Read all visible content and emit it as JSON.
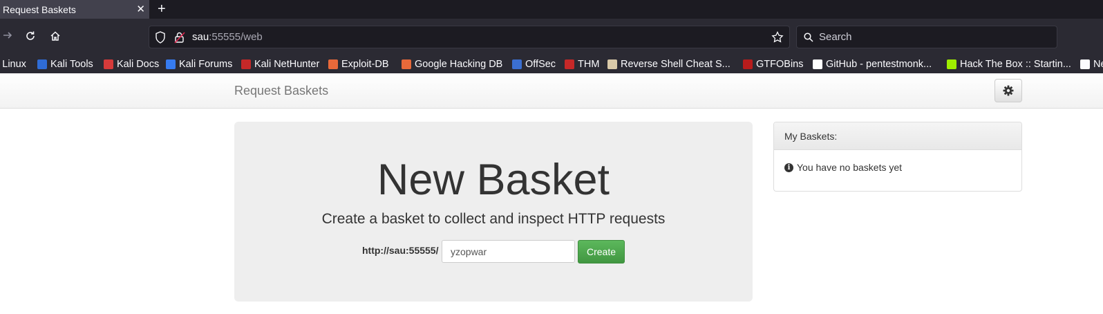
{
  "browser": {
    "tab_title": "Request Baskets",
    "tab_close_glyph": "✕",
    "new_tab_glyph": "+",
    "url_host": "sau",
    "url_rest": ":55555/web",
    "search_placeholder": "Search"
  },
  "bookmarks": [
    {
      "label": "i Linux",
      "color": "#367bf0"
    },
    {
      "label": "Kali Tools",
      "color": "#2f6cd6"
    },
    {
      "label": "Kali Docs",
      "color": "#d63a3a"
    },
    {
      "label": "Kali Forums",
      "color": "#367bf0"
    },
    {
      "label": "Kali NetHunter",
      "color": "#c62828"
    },
    {
      "label": "Exploit-DB",
      "color": "#e8693a"
    },
    {
      "label": "Google Hacking DB",
      "color": "#e8693a"
    },
    {
      "label": "OffSec",
      "color": "#3b6fd1"
    },
    {
      "label": "THM",
      "color": "#c62828"
    },
    {
      "label": "Reverse Shell Cheat S...",
      "color": "#d9c9a8"
    },
    {
      "label": "GTFOBins",
      "color": "#b71c1c"
    },
    {
      "label": "GitHub - pentestmonk...",
      "color": "#ffffff"
    },
    {
      "label": "Hack The Box :: Startin...",
      "color": "#9fef00"
    },
    {
      "label": "Ne",
      "color": "#fbfbfe"
    }
  ],
  "app": {
    "brand": "Request Baskets",
    "jumbotron": {
      "title": "New Basket",
      "lead": "Create a basket to collect and inspect HTTP requests",
      "url_prefix": "http://sau:55555/",
      "basket_name_value": "yzopwar",
      "create_label": "Create"
    },
    "my_baskets": {
      "heading": "My Baskets:",
      "empty_message": "You have no baskets yet"
    }
  },
  "colors": {
    "create_button": "#449d44",
    "browser_chrome": "#2b2a33"
  }
}
